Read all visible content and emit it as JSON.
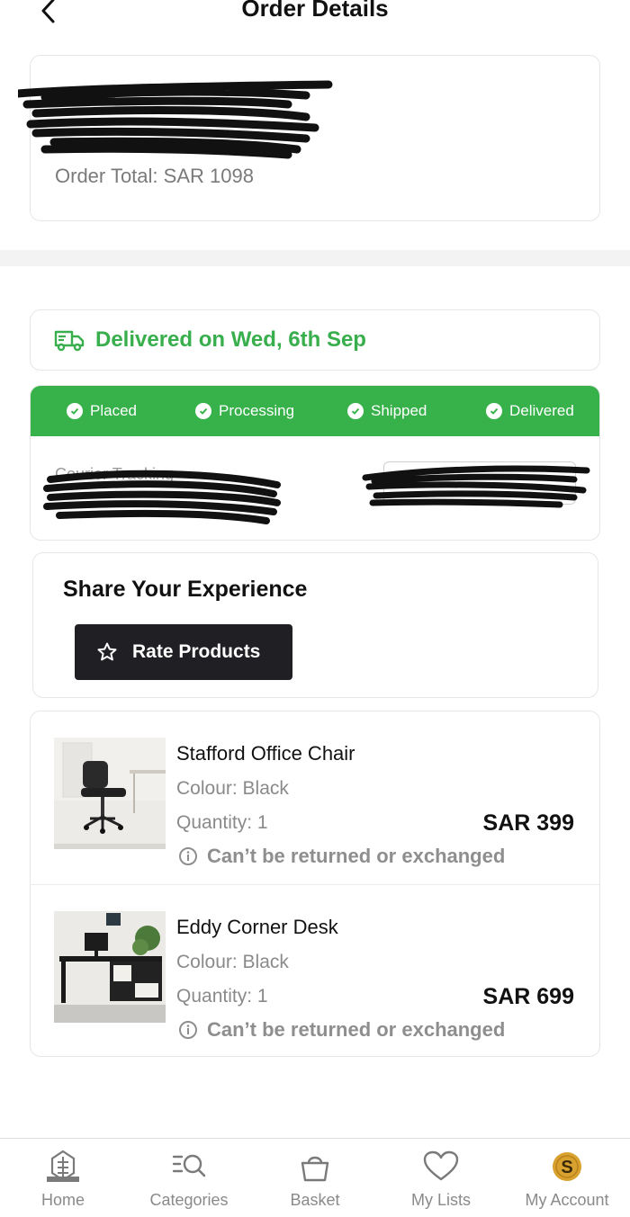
{
  "header": {
    "title": "Order Details"
  },
  "order": {
    "total": "Order Total: SAR 1098"
  },
  "delivery": {
    "status": "Delivered on Wed, 6th Sep",
    "status_color": "#38ae4c"
  },
  "tracker": {
    "steps": [
      {
        "label": "Placed"
      },
      {
        "label": "Processing"
      },
      {
        "label": "Shipped"
      },
      {
        "label": "Delivered"
      }
    ],
    "bar_color": "#37b24a",
    "courier_label": "Courier Tracking"
  },
  "share": {
    "title": "Share Your Experience",
    "rate_label": "Rate Products"
  },
  "items": [
    {
      "name": "Stafford Office Chair",
      "colour": "Colour: Black",
      "quantity": "Quantity: 1",
      "price": "SAR 399",
      "note": "Can’t be returned or exchanged",
      "image_icon": "office-chair-image"
    },
    {
      "name": "Eddy Corner Desk",
      "colour": "Colour: Black",
      "quantity": "Quantity: 1",
      "price": "SAR 699",
      "note": "Can’t be returned or exchanged",
      "image_icon": "corner-desk-image"
    }
  ],
  "tabbar": {
    "tabs": [
      {
        "label": "Home",
        "icon": "home-logo-icon"
      },
      {
        "label": "Categories",
        "icon": "categories-search-icon"
      },
      {
        "label": "Basket",
        "icon": "basket-icon"
      },
      {
        "label": "My Lists",
        "icon": "heart-icon"
      },
      {
        "label": "My Account",
        "icon": "account-coin-icon"
      }
    ]
  }
}
